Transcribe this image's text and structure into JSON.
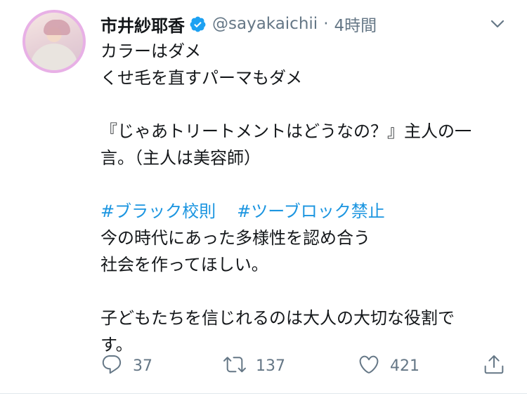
{
  "user": {
    "display_name": "市井紗耶香",
    "handle": "@sayakaichii",
    "separator": "·",
    "time": "4時間",
    "verified": true
  },
  "tweet": {
    "lines": [
      "カラーはダメ",
      "くせ毛を直すパーマもダメ",
      "",
      "『じゃあトリートメントはどうなの？』主人の一",
      "言。（主人は美容師）",
      "",
      "HASHTAGS",
      "今の時代にあった多様性を認め合う",
      "社会を作ってほしい。",
      "",
      "子どもたちを信じれるのは大人の大切な役割で",
      "す。"
    ],
    "hashtags": [
      "#ブラック校則",
      "#ツーブロック禁止"
    ]
  },
  "actions": {
    "reply_count": "37",
    "retweet_count": "137",
    "like_count": "421"
  },
  "colors": {
    "link": "#1b95e0",
    "meta": "#657786",
    "verified": "#1da1f2"
  },
  "icons": [
    "reply-icon",
    "retweet-icon",
    "like-icon",
    "share-icon",
    "verified-badge-icon",
    "chevron-down-icon"
  ]
}
